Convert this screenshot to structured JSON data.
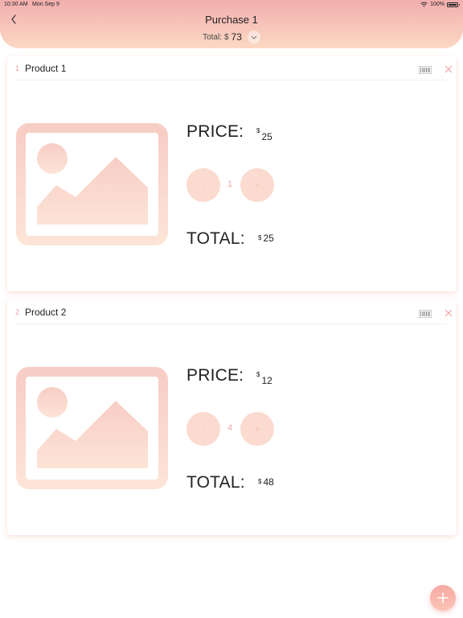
{
  "status_bar": {
    "time": "10:30 AM",
    "date": "Mon Sep 9",
    "battery": "100%"
  },
  "header": {
    "title": "Purchase 1",
    "total_label": "Total:",
    "currency": "$",
    "total_value": "73"
  },
  "products": [
    {
      "index": "1",
      "name": "Product 1",
      "price_label": "PRICE:",
      "currency": "$",
      "price": "25",
      "minus": "-",
      "plus": "+",
      "quantity": "1",
      "total_label": "TOTAL:",
      "total": "25"
    },
    {
      "index": "2",
      "name": "Product 2",
      "price_label": "PRICE:",
      "currency": "$",
      "price": "12",
      "minus": "-",
      "plus": "+",
      "quantity": "4",
      "total_label": "TOTAL:",
      "total": "48"
    }
  ],
  "colors": {
    "accent": "#f09a9a",
    "header_top": "#f2aeae",
    "header_bottom": "#fcd8c4",
    "stepper": "#fbdacf"
  },
  "icons": [
    "back-chevron-icon",
    "chevron-down-icon",
    "barcode-icon",
    "close-icon",
    "image-placeholder-icon",
    "plus-icon",
    "wifi-icon",
    "battery-icon"
  ]
}
